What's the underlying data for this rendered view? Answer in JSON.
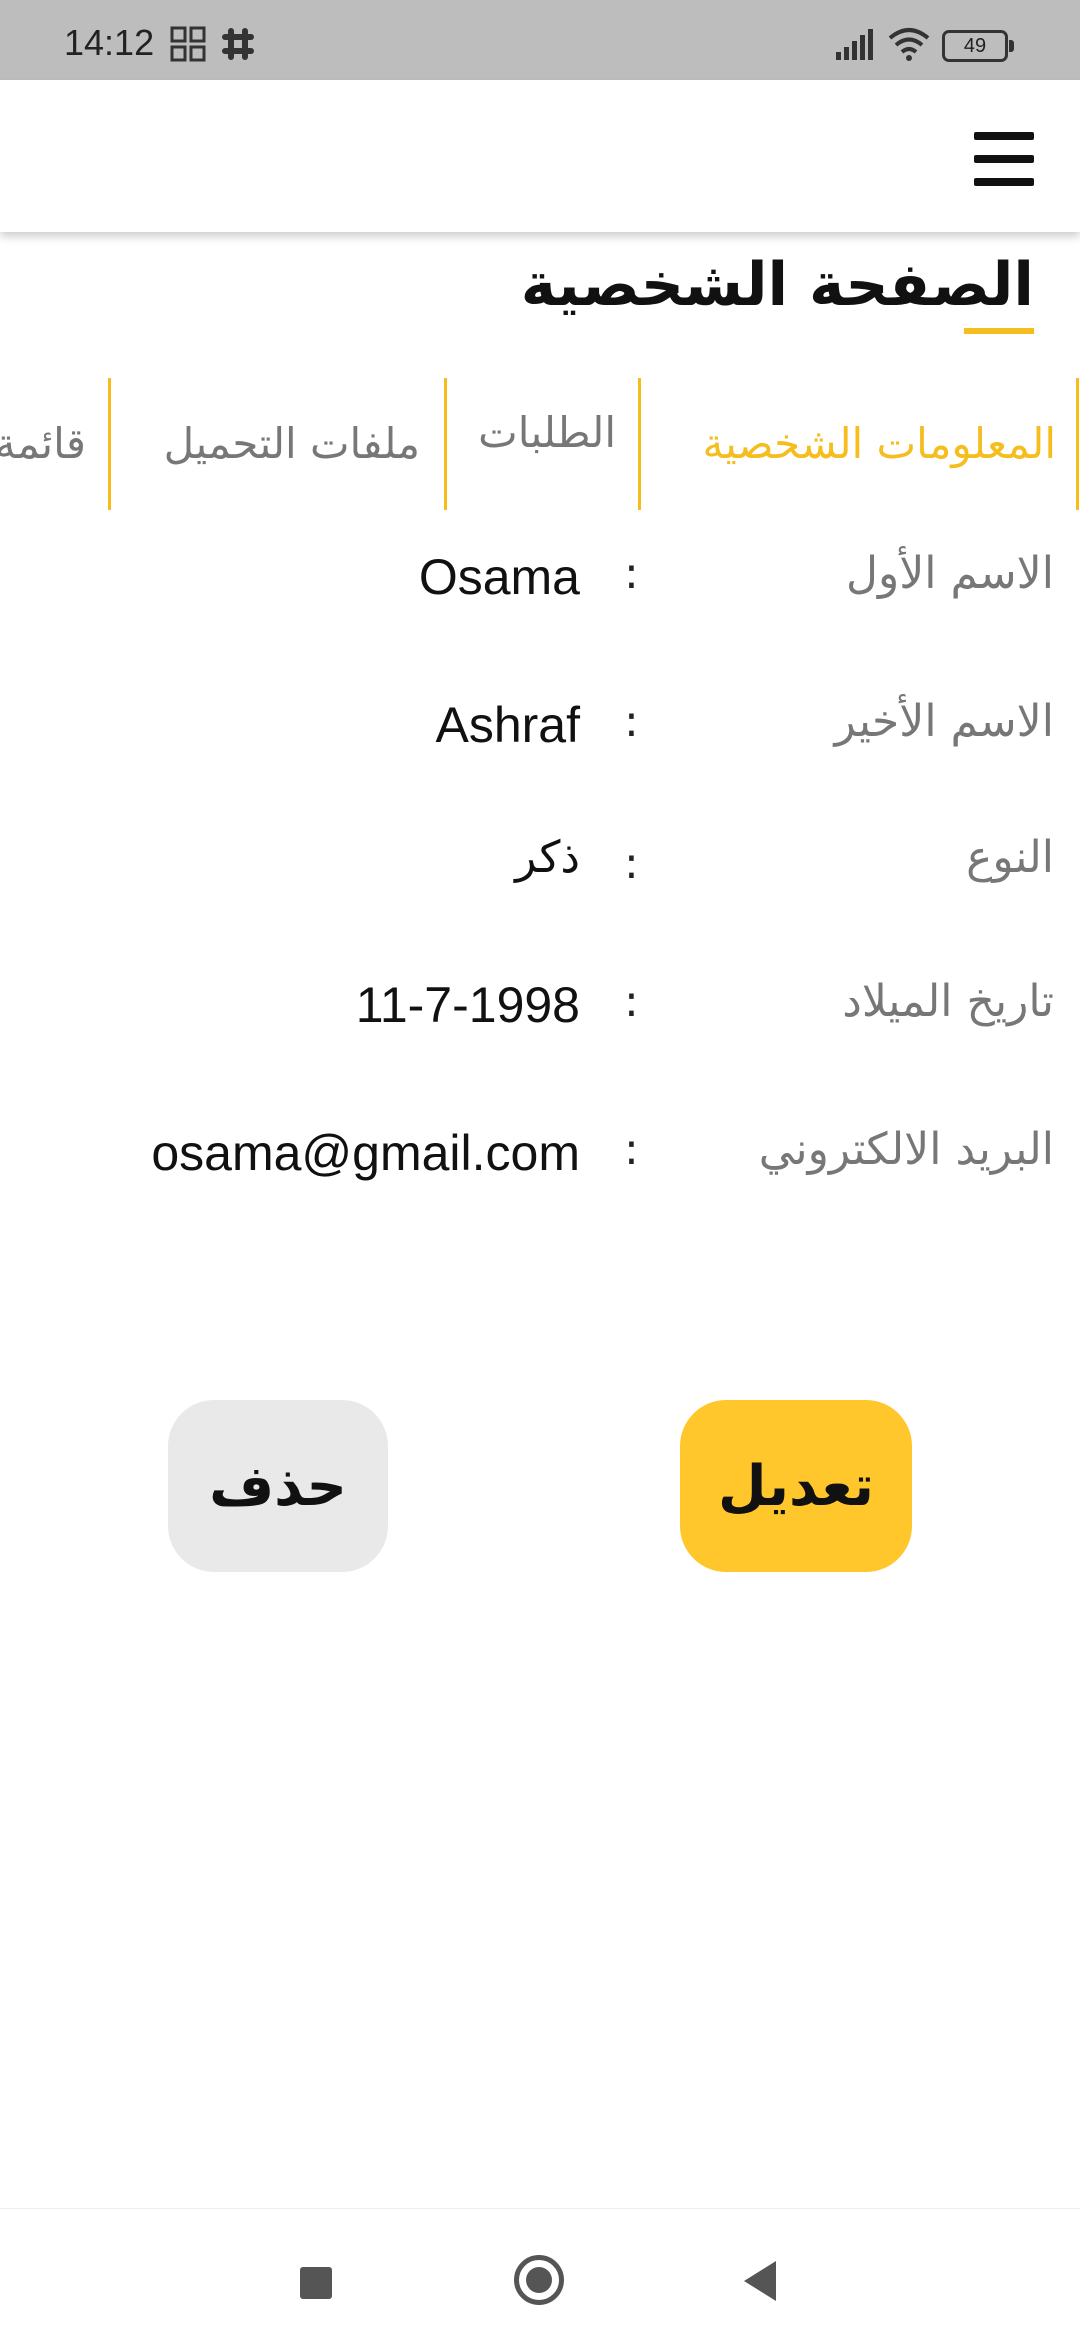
{
  "status_bar": {
    "time": "14:12",
    "battery_level": "49",
    "icons": [
      "grid-app-icon",
      "slack-icon",
      "signal-icon",
      "wifi-icon",
      "battery-icon"
    ]
  },
  "app_bar": {
    "menu_icon": "hamburger-menu-icon"
  },
  "page": {
    "title": "الصفحة الشخصية"
  },
  "tabs": [
    {
      "label": "المعلومات الشخصية",
      "active": true
    },
    {
      "label": "الطلبات",
      "active": false
    },
    {
      "label": "ملفات التحميل",
      "active": false
    },
    {
      "label": "قائمة",
      "active": false
    }
  ],
  "profile": {
    "separator": ":",
    "rows": [
      {
        "label": "الاسم الأول",
        "value": "Osama"
      },
      {
        "label": "الاسم الأخير",
        "value": "Ashraf"
      },
      {
        "label": "النوع",
        "value": "ذكر"
      },
      {
        "label": "تاريخ الميلاد",
        "value": "11-7-1998"
      },
      {
        "label": "البريد الالكتروني",
        "value": "osama@gmail.com"
      }
    ]
  },
  "actions": {
    "edit_label": "تعديل",
    "delete_label": "حذف"
  },
  "colors": {
    "accent": "#f5be1e",
    "edit_button": "#ffc72c",
    "delete_button": "#e9e9e9",
    "status_bar": "#bdbdbd"
  },
  "nav_bar": {
    "icons": [
      "recent-apps-icon",
      "home-icon",
      "back-icon"
    ]
  }
}
